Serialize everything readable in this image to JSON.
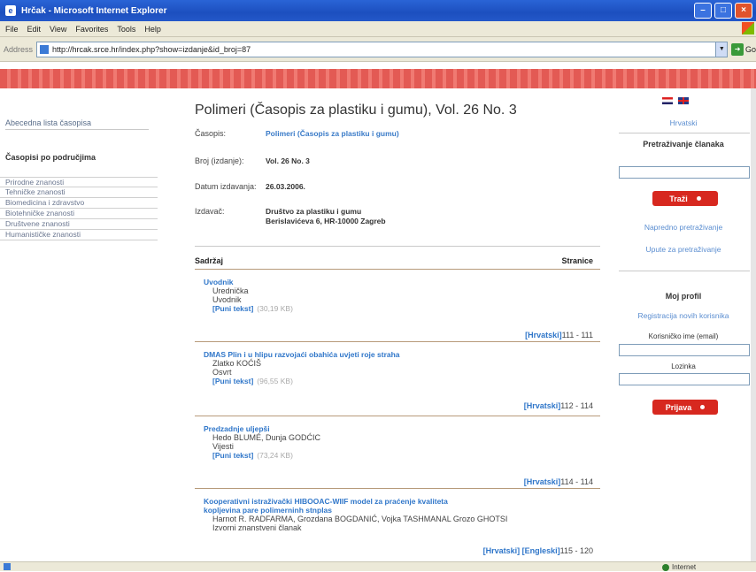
{
  "window": {
    "title": "Hrčak - Microsoft Internet Explorer"
  },
  "menu": [
    "File",
    "Edit",
    "View",
    "Favorites",
    "Tools",
    "Help"
  ],
  "address": {
    "label": "Address",
    "url": "http://hrcak.srce.hr/index.php?show=izdanje&id_broj=87",
    "go": "Go"
  },
  "left": {
    "link": "Abecedna lista časopisa",
    "heading": "Časopisi po područjima",
    "areas": [
      "Prirodne znanosti",
      "Tehničke znanosti",
      "Biomedicina i zdravstvo",
      "Biotehničke znanosti",
      "Društvene znanosti",
      "Humanističke znanosti"
    ]
  },
  "main": {
    "title": "Polimeri (Časopis za plastiku i gumu), Vol. 26 No. 3",
    "casopis_label": "Časopis:",
    "casopis_value": "Polimeri (Časopis za plastiku i gumu)",
    "broj_label": "Broj (izdanje):",
    "broj_value": "Vol. 26 No. 3",
    "datum_label": "Datum izdavanja:",
    "datum_value": "26.03.2006.",
    "izdavac_label": "Izdavač:",
    "izdavac_line1": "Društvo za plastiku i gumu",
    "izdavac_line2": "Berislavićeva 6, HR-10000 Zagreb",
    "sadrzaj": "Sadržaj",
    "stranice": "Stranice",
    "articles": [
      {
        "title": "Uvodnik",
        "a1": "Urednička",
        "a2": "Uvodnik",
        "fulltext": "[Puni tekst]",
        "size": "(30,19 KB)",
        "abstract": "[Hrvatski]",
        "pages": "111 - 111"
      },
      {
        "title": "DMAS Plin i u hlipu razvojaći obahića uvjeti roje straha",
        "a1": "Zlatko KOĆIŠ",
        "a2": "Osvrt",
        "fulltext": "[Puni tekst]",
        "size": "(96,55 KB)",
        "abstract": "[Hrvatski]",
        "pages": "112 - 114"
      },
      {
        "title": "Predzadnje uljepši",
        "a1": "Hedo BLUMÉ, Dunja GODĆIC",
        "a2": "Vijesti",
        "fulltext": "[Puni tekst]",
        "size": "(73,24 KB)",
        "abstract": "[Hrvatski]",
        "pages": "114 - 114"
      },
      {
        "title": "Kooperativni istraživački HIBOOAC-WIIF model za praćenje kvaliteta",
        "title2": "kopljevina pare polimerninh stnplas",
        "a1": "Harnot R. RADFARMA, Grozdana BOGDANIĆ, Vojka TASHMANAL Grozo GHOTSI",
        "a2": "Izvorni znanstveni članak",
        "abstract": "[Hrvatski]",
        "abstract2": "[Engleski]",
        "pages": "115 - 120"
      }
    ]
  },
  "right": {
    "lang_label": "Hrvatski",
    "search_heading": "Pretraživanje članaka",
    "search_button": "Traži",
    "adv_search": "Napredno pretraživanje",
    "search_help": "Upute za pretraživanje",
    "profile_heading": "Moj profil",
    "register_link": "Registracija novih korisnika",
    "email_label": "Korisničko ime (email)",
    "password_label": "Lozinka",
    "login_button": "Prijava"
  },
  "status": {
    "zone": "Internet"
  }
}
